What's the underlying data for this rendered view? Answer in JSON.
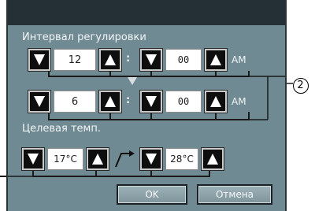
{
  "labels": {
    "interval": "Интервал регулировки",
    "target": "Целевая темп."
  },
  "rows": [
    {
      "hour": "12",
      "minute": "00",
      "ampm": "AM"
    },
    {
      "hour": "6",
      "minute": "00",
      "ampm": "AM"
    }
  ],
  "temps": {
    "low": "17°C",
    "high": "28°C"
  },
  "buttons": {
    "ok": "OK",
    "cancel": "Отмена"
  },
  "separator": ":",
  "callout": "2",
  "icons": {
    "down": "down-triangle",
    "up": "up-triangle",
    "arrow": "step-arrow"
  },
  "colors": {
    "screen": "#6f8a93",
    "titlebar": "#243036",
    "spin_button": "#0e0e0e"
  }
}
